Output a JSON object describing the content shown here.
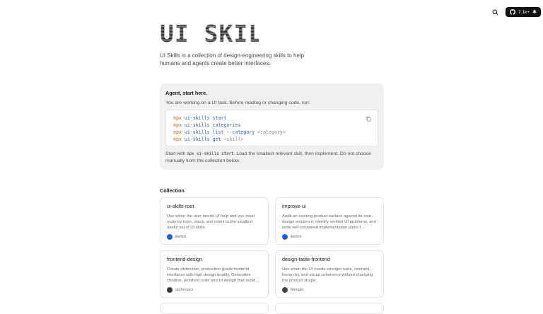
{
  "header": {
    "search_icon": "search-icon",
    "github_count": "7.1k+",
    "github_icon": "github-icon",
    "star_icon": "star-icon"
  },
  "logo": {
    "text": "UI SKILLS"
  },
  "intro": "UI Skills is a collection of design-engineering skills to help humans and agents create better interfaces.",
  "agent": {
    "title": "Agent, start here.",
    "description": "You are working on a UI task. Before reading or changing code, run:",
    "commands": [
      {
        "cmd": "npx",
        "args": "ui-skills start",
        "placeholder": ""
      },
      {
        "cmd": "npx",
        "args": "ui-skills categories",
        "placeholder": ""
      },
      {
        "cmd": "npx",
        "args": "ui-skills list --category",
        "placeholder": "<category>"
      },
      {
        "cmd": "npx",
        "args": "ui-skills get",
        "placeholder": "<skill>"
      }
    ],
    "footer_before": "Start with",
    "footer_code": "npx ui-skills start",
    "footer_after": ". Load the smallest relevant skill, then implement. Do not choose manually from the collection below.",
    "copy_icon": "copy-icon"
  },
  "collection": {
    "title": "Collection",
    "cards": [
      {
        "title": "ui-skills-root",
        "description": "Use when the user needs UI help and you must route by topic, stack, and intent to the smallest useful set of UI skills.",
        "author": "ibelick",
        "avatar_color": "#1f5fd6"
      },
      {
        "title": "improve-ui",
        "description": "Audit an existing product surface against its own design existence, identify verified UI problems, and write self-contained implementation plans f...",
        "author": "ibelick",
        "avatar_color": "#1f5fd6"
      },
      {
        "title": "frontend-design",
        "description": "Create distinctive, production-grade frontend interfaces with high design quality. Generates creative, polished code and UI design that avoid...",
        "author": "anthropics",
        "avatar_color": "#3a3a3a"
      },
      {
        "title": "design-taste-frontend",
        "description": "Use when the UI needs stronger taste, restraint, hierarchy, and visual coherence without changing the product shape.",
        "author": "Mengto",
        "avatar_color": "#444444"
      }
    ]
  }
}
